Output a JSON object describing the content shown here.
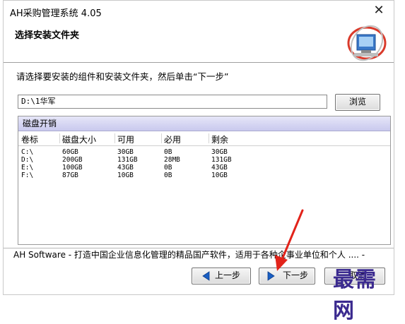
{
  "window": {
    "title": "AH采购管理系统 4.05",
    "close_glyph": "✕"
  },
  "header": {
    "heading": "选择安装文件夹",
    "instruction": "请选择要安装的组件和安装文件夹，然后单击“下一步”"
  },
  "path": {
    "value": "D:\\1华军",
    "browse_label": "浏览"
  },
  "disk": {
    "title": "磁盘开销",
    "columns": [
      "卷标",
      "磁盘大小",
      "可用",
      "必用",
      "剩余"
    ],
    "rows": [
      [
        "C:\\",
        "60GB",
        "30GB",
        "0B",
        "30GB"
      ],
      [
        "D:\\",
        "200GB",
        "131GB",
        "28MB",
        "131GB"
      ],
      [
        "E:\\",
        "100GB",
        "43GB",
        "0B",
        "43GB"
      ],
      [
        "F:\\",
        "87GB",
        "10GB",
        "0B",
        "10GB"
      ]
    ]
  },
  "footer": {
    "text": "AH Software - 打造中国企业信息化管理的精品国产软件，适用于各种企事业单位和个人 .... -"
  },
  "buttons": {
    "back": "上一步",
    "next": "下一步",
    "cancel": "取消"
  },
  "watermark": "最需网",
  "colors": {
    "disk_title_bg": "#c9c9ee",
    "arrow_blue": "#1a5fc4",
    "annotation_red": "#e2231a",
    "watermark": "#3b2a8f"
  }
}
